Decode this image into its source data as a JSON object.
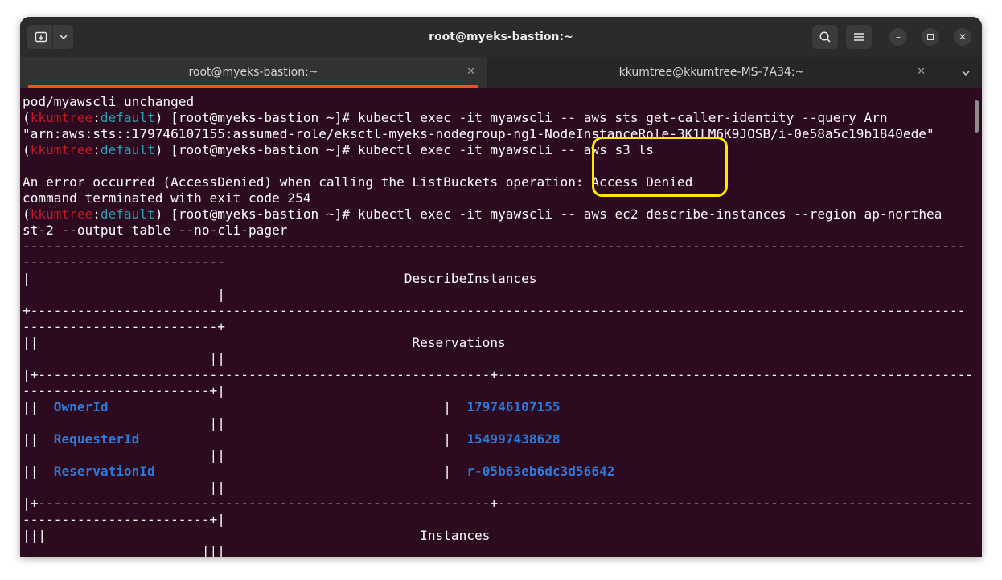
{
  "window": {
    "title": "root@myeks-bastion:~",
    "new_tab_icon": "new-tab-icon",
    "tabs": [
      {
        "label": "root@myeks-bastion:~",
        "close": "✕"
      },
      {
        "label": "kkumtree@kkumtree-MS-7A34:~",
        "close": "✕"
      }
    ],
    "accent_color": "#e95420"
  },
  "colors": {
    "background": "#2c0a1f",
    "text": "#ffffff",
    "prompt_user": "#c01c28",
    "prompt_context": "#2aa1b3",
    "table_value": "#2a7bde",
    "highlight": "#ffe600"
  },
  "prompt": {
    "user": "kkumtree",
    "context": "default",
    "host": "root@myeks-bastion ~"
  },
  "terminal": {
    "l1": "pod/myawscli unchanged",
    "cmd1": "kubectl exec -it myawscli -- aws sts get-caller-identity --query Arn",
    "l3": "\"arn:aws:sts::179746107155:assumed-role/eksctl-myeks-nodegroup-ng1-NodeInstanceRole-3K1LM6K9JOSB/i-0e58a5c19b1840ede\"",
    "cmd2": "kubectl exec -it myawscli -- aws s3 ls",
    "l5": "",
    "l6": "An error occurred (AccessDenied) when calling the ListBuckets operation: Access Denied",
    "l7": "command terminated with exit code 254",
    "cmd3": "kubectl exec -it myawscli -- aws ec2 describe-instances --region ap-northea",
    "l9": "st-2 --output table --no-cli-pager",
    "l10": "-------------------------------------------------------------------------------------------------------------------------",
    "l11": "--------------------------",
    "l12": "|                                                DescribeInstances",
    "l13": "                         |",
    "l14": "+------------------------------------------------------------------------------------------------------------------------",
    "l15": "-------------------------+",
    "l16": "||                                                Reservations",
    "l17": "                        ||",
    "l18": "|+----------------------------------------------------------+-------------------------------------------------------------",
    "l19": "------------------------+|",
    "l20_key": "OwnerId",
    "l20_val": "179746107155",
    "l21": "                        ||",
    "l22_key": "RequesterId",
    "l22_val": "154997438628",
    "l23": "                        ||",
    "l24_key": "ReservationId",
    "l24_val": "r-05b63eb6dc3d56642",
    "l25": "                        ||",
    "l26": "|+----------------------------------------------------------+-------------------------------------------------------------",
    "l27": "------------------------+|",
    "l28": "|||                                                Instances",
    "l29": "                       |||"
  }
}
